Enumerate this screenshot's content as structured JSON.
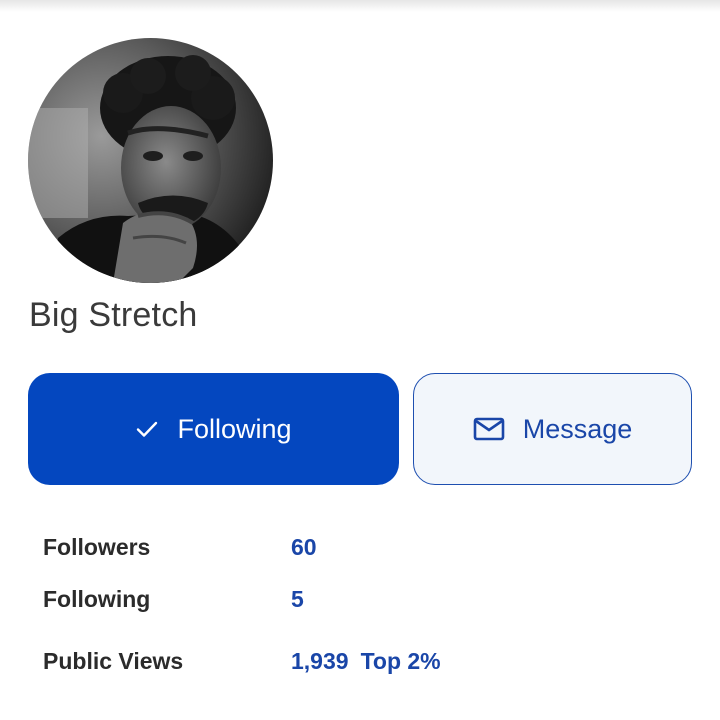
{
  "profile": {
    "name": "Big Stretch",
    "avatar_icon": "profile-photo"
  },
  "actions": {
    "following_label": "Following",
    "following_icon": "check-icon",
    "message_label": "Message",
    "message_icon": "mail-icon"
  },
  "stats": {
    "followers_label": "Followers",
    "followers_value": "60",
    "following_label": "Following",
    "following_value": "5",
    "views_label": "Public Views",
    "views_value": "1,939",
    "views_rank": "Top 2%"
  },
  "colors": {
    "primary": "#0447bf",
    "link": "#1a46a8",
    "secondary_bg": "#f2f6fb"
  }
}
